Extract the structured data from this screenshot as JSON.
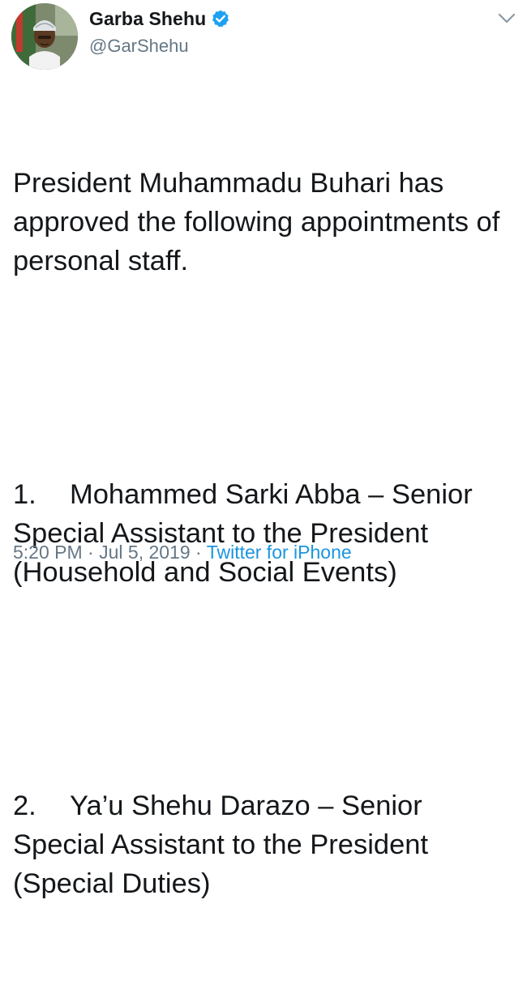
{
  "author": {
    "display_name": "Garba Shehu",
    "handle": "@GarShehu",
    "verified": true,
    "avatar": "profile-photo",
    "verified_icon": "verified-badge-icon",
    "menu_icon": "chevron-down-icon"
  },
  "tweet": {
    "intro": "President Muhammadu Buhari has approved the following appointments of personal staff.",
    "items": [
      {
        "number": "1.",
        "text": "Mohammed Sarki Abba – Senior Special Assistant to the President (Household and Social Events)"
      },
      {
        "number": "2.",
        "text": "Ya’u Shehu Darazo – Senior Special Assistant to the President (Special Duties)"
      }
    ]
  },
  "meta": {
    "time": "5:20 PM",
    "separator": "·",
    "date": "Jul 5, 2019",
    "source": "Twitter for iPhone"
  },
  "colors": {
    "text": "#14171a",
    "secondary": "#657786",
    "link": "#1b95e0",
    "verified": "#1da1f2"
  }
}
